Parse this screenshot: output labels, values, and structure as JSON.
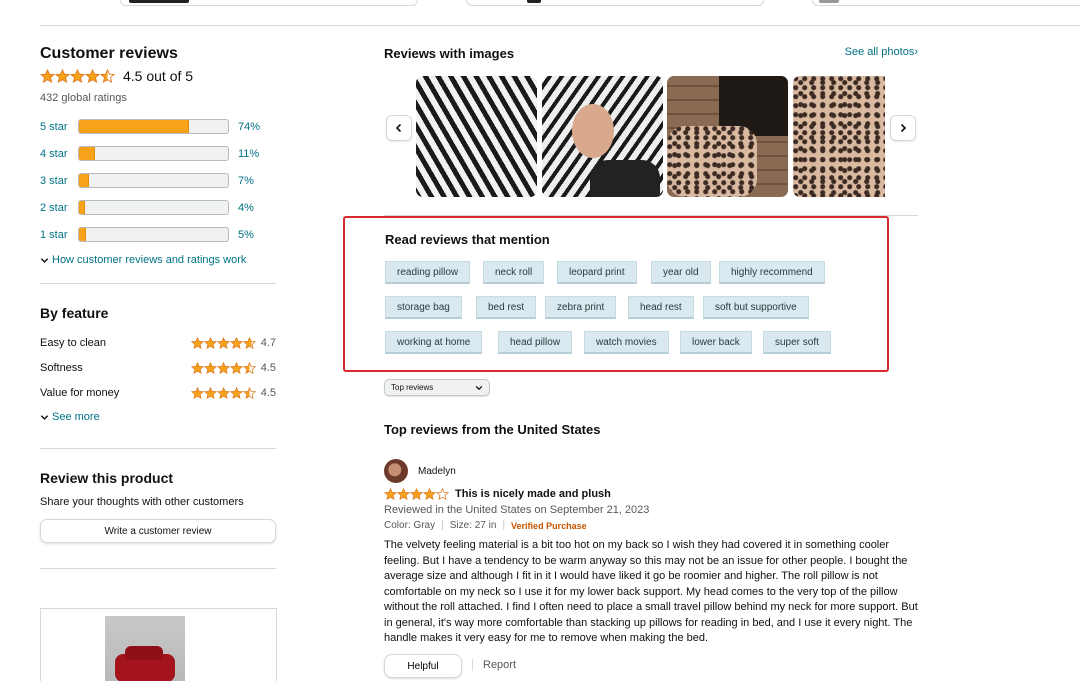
{
  "colors": {
    "accent_link": "#007185",
    "star": "#f7a21b",
    "highlight_box": "#d5282e",
    "verified": "#c45500"
  },
  "summary": {
    "title": "Customer reviews",
    "average": 4.5,
    "average_text": "4.5 out of 5",
    "global_ratings": "432 global ratings",
    "histogram": [
      {
        "label": "5 star",
        "percent": 74,
        "percent_text": "74%"
      },
      {
        "label": "4 star",
        "percent": 11,
        "percent_text": "11%"
      },
      {
        "label": "3 star",
        "percent": 7,
        "percent_text": "7%"
      },
      {
        "label": "2 star",
        "percent": 4,
        "percent_text": "4%"
      },
      {
        "label": "1 star",
        "percent": 5,
        "percent_text": "5%"
      }
    ],
    "how_link": "How customer reviews and ratings work"
  },
  "by_feature": {
    "title": "By feature",
    "items": [
      {
        "name": "Easy to clean",
        "rating": 4.7,
        "rating_text": "4.7"
      },
      {
        "name": "Softness",
        "rating": 4.5,
        "rating_text": "4.5"
      },
      {
        "name": "Value for money",
        "rating": 4.5,
        "rating_text": "4.5"
      }
    ],
    "see_more": "See more"
  },
  "review_product": {
    "title": "Review this product",
    "subtitle": "Share your thoughts with other customers",
    "button": "Write a customer review"
  },
  "images": {
    "title": "Reviews with images",
    "see_all": "See all photos"
  },
  "mentions": {
    "title": "Read reviews that mention",
    "chips": [
      [
        "reading pillow",
        "neck roll",
        "leopard print",
        "year old",
        "highly recommend"
      ],
      [
        "storage bag",
        "bed rest",
        "zebra print",
        "head rest",
        "soft but supportive"
      ],
      [
        "working at home",
        "head pillow",
        "watch movies",
        "lower back",
        "super soft"
      ]
    ]
  },
  "sort": {
    "selected": "Top reviews"
  },
  "top_reviews": {
    "title": "Top reviews from the United States",
    "review": {
      "author": "Madelyn",
      "rating": 4,
      "headline": "This is nicely made and plush",
      "date": "Reviewed in the United States on September 21, 2023",
      "color": "Color: Gray",
      "size": "Size: 27 in",
      "verified": "Verified Purchase",
      "body": "The velvety feeling material is a bit too hot on my back so I wish they had covered it in something cooler feeling. But I have a tendency to be warm anyway so this may not be an issue for other people. I bought the average size and although I fit in it I would have liked it go be roomier and higher. The roll pillow is not comfortable on my neck so I use it for my lower back support. My head comes to the very top of the pillow without the roll attached. I find I often need to place a small travel pillow behind my neck for more support. But in general, it's way more comfortable than stacking up pillows for reading in bed, and I use it every night. The handle makes it very easy for me to remove when making the bed.",
      "helpful": "Helpful",
      "report": "Report"
    }
  }
}
